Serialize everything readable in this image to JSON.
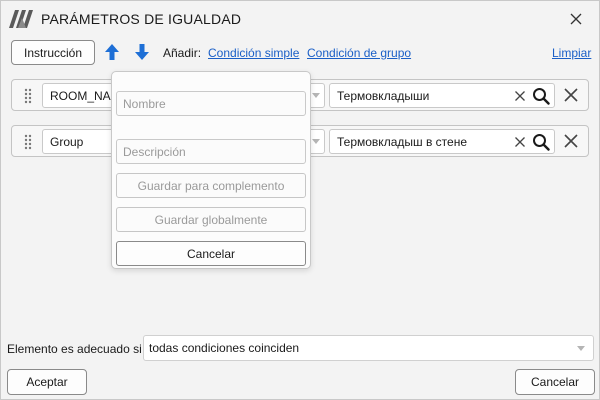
{
  "window": {
    "title": "PARÁMETROS DE IGUALDAD"
  },
  "toolbar": {
    "instruction_label": "Instrucción",
    "add_label": "Añadir:",
    "simple_condition_link": "Condición simple",
    "group_condition_link": "Condición de grupo",
    "clear_link": "Limpiar"
  },
  "conditions": [
    {
      "parameter": "ROOM_NAM",
      "value": "Термовкладыши"
    },
    {
      "parameter": "Group",
      "value": "Термовкладыш в стене"
    }
  ],
  "save_popup": {
    "name_placeholder": "Nombre",
    "description_placeholder": "Descripción",
    "save_complement_label": "Guardar para complemento",
    "save_global_label": "Guardar globalmente",
    "cancel_label": "Cancelar"
  },
  "footer": {
    "fit_label": "Elemento es adecuado si",
    "fit_value": "todas condiciones coinciden",
    "accept_label": "Aceptar",
    "cancel_label": "Cancelar"
  },
  "colors": {
    "link": "#1a5fc7",
    "arrow": "#1e6fd6",
    "logo": "#5a5a5a"
  }
}
